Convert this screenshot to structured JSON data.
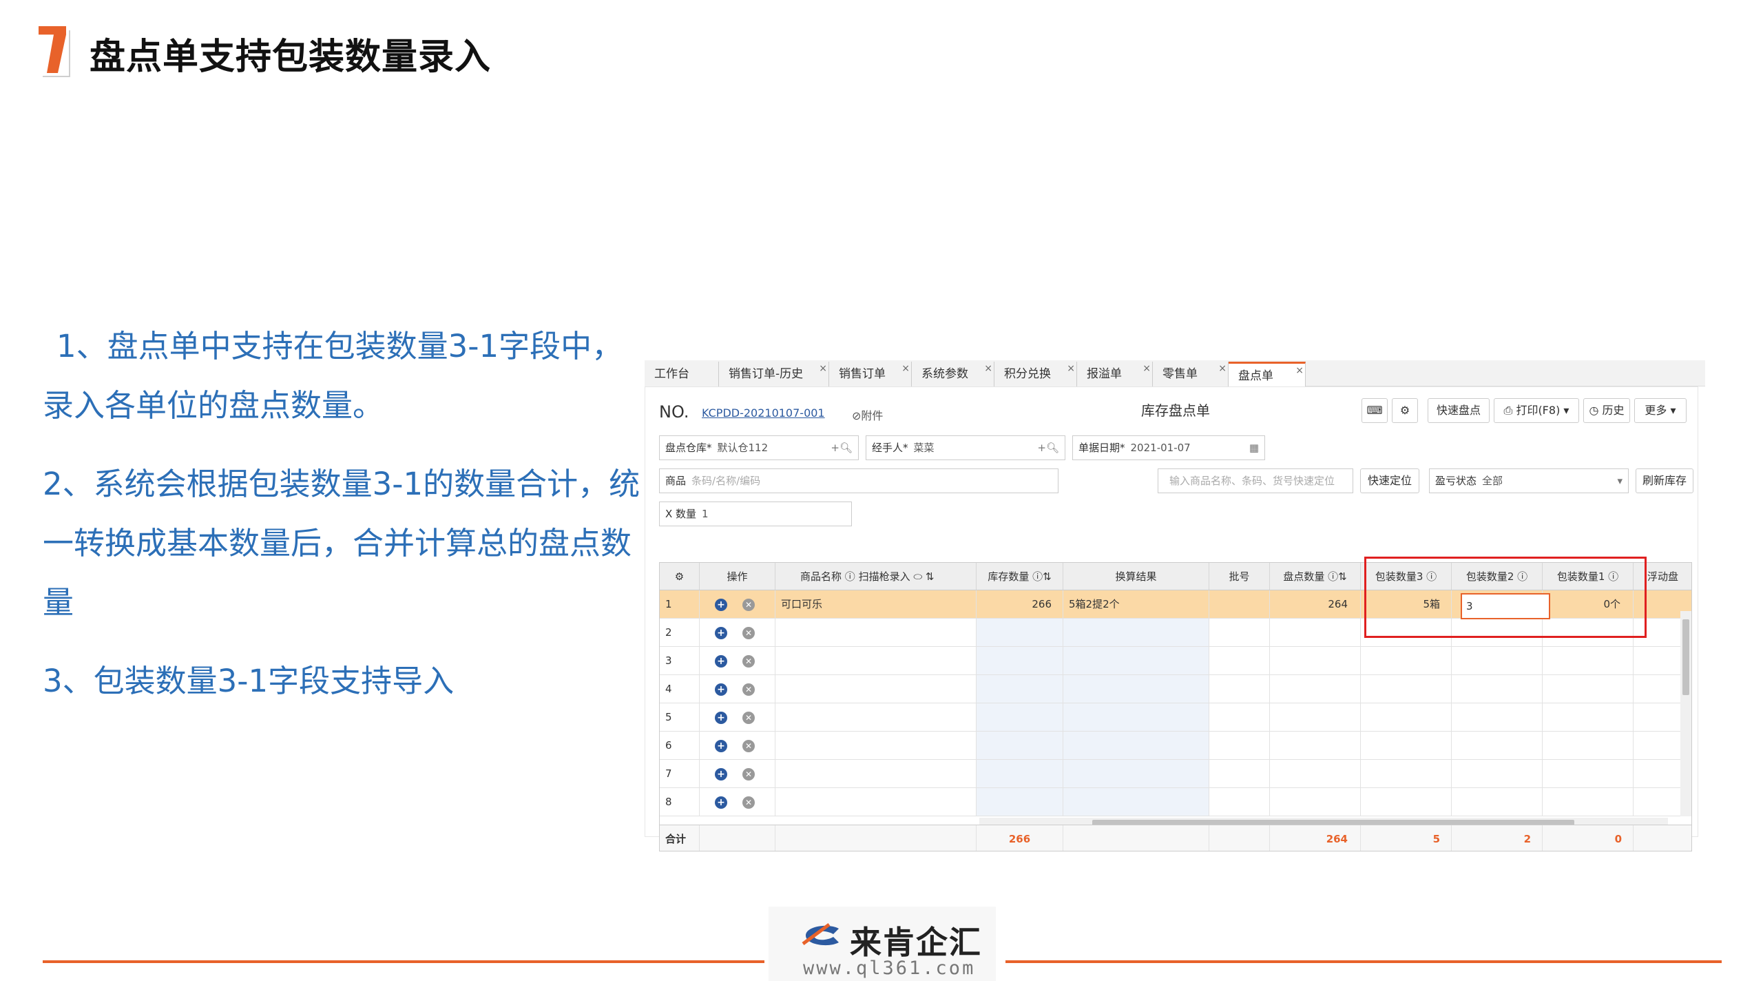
{
  "page": {
    "title": "盘点单支持包装数量录入",
    "points": [
      "1、盘点单中支持在包装数量3-1字段中，录入各单位的盘点数量。",
      "2、系统会根据包装数量3-1的数量合计，统一转换成基本数量后，合并计算总的盘点数量",
      "3、包装数量3-1字段支持导入"
    ]
  },
  "screenshot": {
    "tabs": [
      {
        "label": "工作台",
        "closable": false
      },
      {
        "label": "销售订单-历史",
        "closable": true
      },
      {
        "label": "销售订单",
        "closable": true
      },
      {
        "label": "系统参数",
        "closable": true
      },
      {
        "label": "积分兑换",
        "closable": true
      },
      {
        "label": "报溢单",
        "closable": true
      },
      {
        "label": "零售单",
        "closable": true
      },
      {
        "label": "盘点单",
        "closable": true
      }
    ],
    "header": {
      "no_label": "NO.",
      "no_value": "KCPDD-20210107-001",
      "attach": "⊘附件",
      "doc_title": "库存盘点单",
      "btn_quick": "快速盘点",
      "btn_print": "打印(F8)",
      "btn_history": "历史",
      "btn_more": "更多"
    },
    "fields": {
      "warehouse_label": "盘点仓库*",
      "warehouse_value": "默认仓112",
      "handler_label": "经手人*",
      "handler_value": "菜菜",
      "date_label": "单据日期*",
      "date_value": "2021-01-07",
      "goods_label": "商品",
      "goods_placeholder": "条码/名称/编码",
      "locate_placeholder": "输入商品名称、条码、货号快速定位",
      "btn_locate": "快速定位",
      "status_label": "盈亏状态",
      "status_value": "全部",
      "btn_refresh": "刷新库存",
      "qty_label": "X 数量",
      "qty_value": "1"
    },
    "grid": {
      "headers": [
        "操作",
        "商品名称",
        "扫描枪录入",
        "库存数量",
        "换算结果",
        "批号",
        "盘点数量",
        "包装数量3",
        "包装数量2",
        "包装数量1",
        "浮动盘"
      ],
      "rows": [
        {
          "no": "1",
          "name": "可口可乐",
          "stock": "266",
          "convert": "5箱2提2个",
          "batch": "",
          "count": "264",
          "pk3": "5箱",
          "pk2": "3",
          "pk1": "0个"
        },
        {
          "no": "2"
        },
        {
          "no": "3"
        },
        {
          "no": "4"
        },
        {
          "no": "5"
        },
        {
          "no": "6"
        },
        {
          "no": "7"
        },
        {
          "no": "8"
        }
      ],
      "total_label": "合计",
      "totals": {
        "stock": "266",
        "count": "264",
        "pk3": "5",
        "pk2": "2",
        "pk1": "0"
      }
    }
  },
  "footer": {
    "brand": "来肯企汇",
    "url": "www.ql361.com"
  }
}
